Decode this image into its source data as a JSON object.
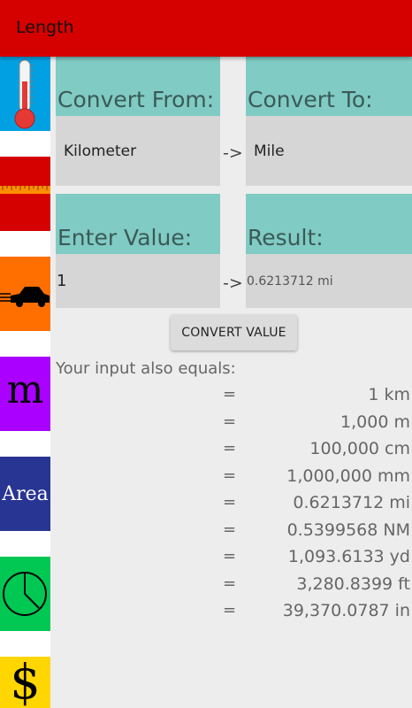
{
  "app_bar": {
    "title": "Length"
  },
  "sidebar": {
    "items": [
      {
        "id": "temperature",
        "icon": "thermometer-icon",
        "bg": "#00a0e3"
      },
      {
        "id": "length",
        "icon": "ruler-icon",
        "bg": "#d50000"
      },
      {
        "id": "speed",
        "icon": "car-icon",
        "bg": "#ff6f00"
      },
      {
        "id": "mass",
        "icon": "m-letter-icon",
        "label": "m",
        "bg": "#aa00ff"
      },
      {
        "id": "area",
        "icon": "area-text-icon",
        "label": "Area",
        "bg": "#283593"
      },
      {
        "id": "time",
        "icon": "clock-icon",
        "bg": "#00c853"
      },
      {
        "id": "currency",
        "icon": "dollar-icon",
        "label": "$",
        "bg": "#ffd600"
      }
    ]
  },
  "converter": {
    "from_label": "Convert From:",
    "from_value": "Kilometer",
    "to_label": "Convert To:",
    "to_value": "Mile",
    "arrow": "->",
    "input_label": "Enter Value:",
    "input_value": "1",
    "result_label": "Result:",
    "result_value": "0.6213712 mi",
    "convert_button": "CONVERT VALUE"
  },
  "equals": {
    "heading": "Your input also equals:",
    "sign": "=",
    "rows": [
      "1 km",
      "1,000 m",
      "100,000 cm",
      "1,000,000 mm",
      "0.6213712 mi",
      "0.5399568 NM",
      "1,093.6133 yd",
      "3,280.8399 ft",
      "39,370.0787 in"
    ]
  },
  "colors": {
    "app_bar": "#d50000",
    "header_cell": "#80cbc4",
    "value_cell": "#d6d6d6",
    "background": "#ededed"
  }
}
